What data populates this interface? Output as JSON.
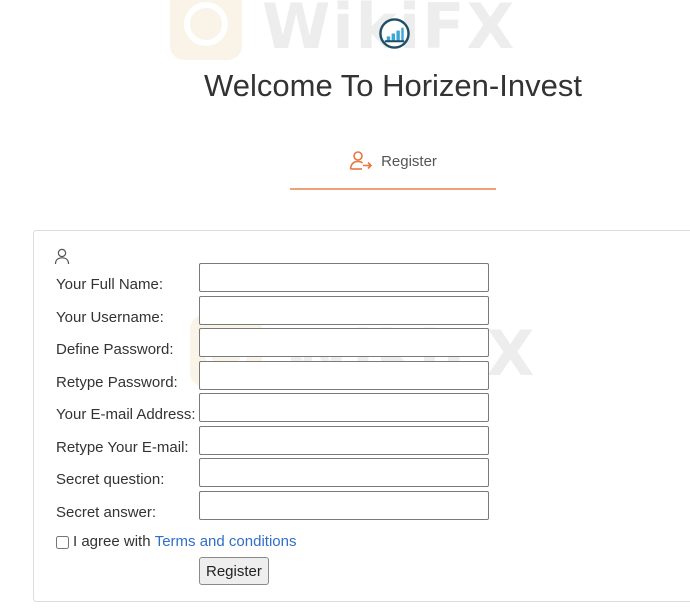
{
  "header": {
    "title": "Welcome To Horizen-Invest",
    "logo_icon": "bar-chart-logo-icon"
  },
  "tabs": [
    {
      "label": "Register",
      "icon": "user-arrow-icon",
      "active": true
    }
  ],
  "colors": {
    "accent": "#f0a17a",
    "link": "#2f6ec9",
    "logo_ring": "#1f4f66",
    "logo_bars": "#3aa7d8"
  },
  "form": {
    "section_icon": "user-outline-icon",
    "fields": [
      {
        "label": "Your Full Name:",
        "value": "",
        "placeholder": ""
      },
      {
        "label": "Your Username:",
        "value": "",
        "placeholder": ""
      },
      {
        "label": "Define Password:",
        "value": "",
        "placeholder": ""
      },
      {
        "label": "Retype Password:",
        "value": "",
        "placeholder": ""
      },
      {
        "label": "Your E-mail Address:",
        "value": "",
        "placeholder": ""
      },
      {
        "label": "Retype Your E-mail:",
        "value": "",
        "placeholder": ""
      },
      {
        "label": "Secret question:",
        "value": "",
        "placeholder": ""
      },
      {
        "label": "Secret answer:",
        "value": "",
        "placeholder": ""
      }
    ],
    "agree_prefix": "I agree with",
    "agree_link": "Terms and conditions",
    "agree_checked": false,
    "submit_label": "Register"
  },
  "watermark": {
    "text": "WikiFX"
  }
}
